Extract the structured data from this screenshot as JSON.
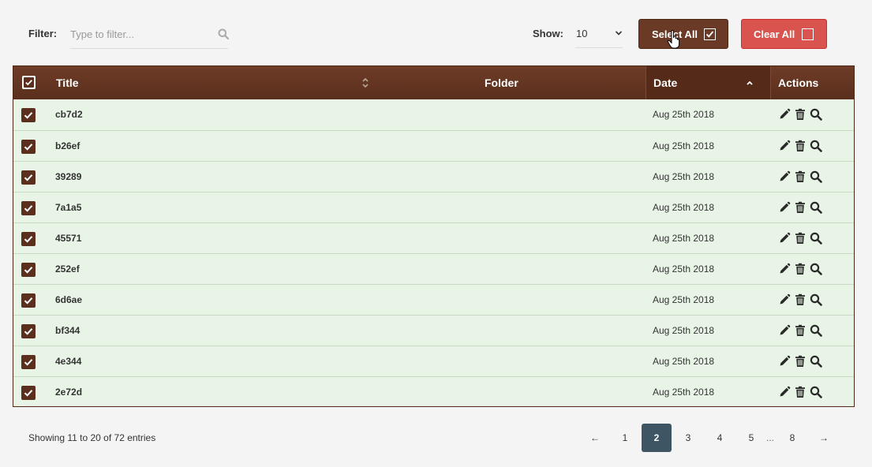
{
  "toolbar": {
    "filter_label": "Filter:",
    "filter_placeholder": "Type to filter...",
    "filter_value": "",
    "show_label": "Show:",
    "show_value": "10",
    "select_all_label": "Select All",
    "clear_all_label": "Clear All"
  },
  "table": {
    "columns": [
      "Title",
      "Folder",
      "Date",
      "Actions"
    ],
    "sort": {
      "column": "Date",
      "direction": "ascending"
    },
    "rows": [
      {
        "title": "cb7d2",
        "folder": "",
        "date": "Aug 25th 2018",
        "checked": true
      },
      {
        "title": "b26ef",
        "folder": "",
        "date": "Aug 25th 2018",
        "checked": true
      },
      {
        "title": "39289",
        "folder": "",
        "date": "Aug 25th 2018",
        "checked": true
      },
      {
        "title": "7a1a5",
        "folder": "",
        "date": "Aug 25th 2018",
        "checked": true
      },
      {
        "title": "45571",
        "folder": "",
        "date": "Aug 25th 2018",
        "checked": true
      },
      {
        "title": "252ef",
        "folder": "",
        "date": "Aug 25th 2018",
        "checked": true
      },
      {
        "title": "6d6ae",
        "folder": "",
        "date": "Aug 25th 2018",
        "checked": true
      },
      {
        "title": "bf344",
        "folder": "",
        "date": "Aug 25th 2018",
        "checked": true
      },
      {
        "title": "4e344",
        "folder": "",
        "date": "Aug 25th 2018",
        "checked": true
      },
      {
        "title": "2e72d",
        "folder": "",
        "date": "Aug 25th 2018",
        "checked": true
      }
    ],
    "row_actions": [
      "pencil-icon",
      "trash-icon",
      "magnifier-icon"
    ]
  },
  "footer": {
    "entries_text": "Showing 11 to 20 of 72 entries",
    "pagination": {
      "prev": "←",
      "pages": [
        "1",
        "2",
        "3",
        "4",
        "5",
        "8"
      ],
      "ellipsis": "...",
      "next": "→",
      "current": "2"
    }
  },
  "colors": {
    "header_brown": "#6b3a26",
    "select_button": "#6b3a26",
    "clear_button": "#d9534f",
    "row_background": "#e8f5e6",
    "active_page": "#3e5664",
    "page_background": "#f4f4f4"
  }
}
